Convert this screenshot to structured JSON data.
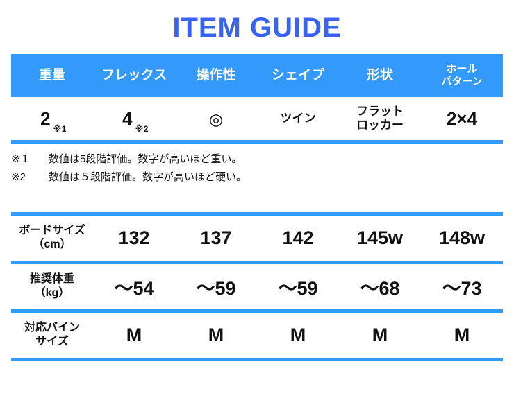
{
  "title": "ITEM GUIDE",
  "colors": {
    "title_blue": "#3663ef",
    "table_blue": "#3399fb",
    "text": "#111111",
    "background": "#ffffff"
  },
  "spec_table": {
    "headers": [
      {
        "label": "重量",
        "line2": ""
      },
      {
        "label": "フレックス",
        "line2": ""
      },
      {
        "label": "操作性",
        "line2": ""
      },
      {
        "label": "シェイプ",
        "line2": ""
      },
      {
        "label": "形状",
        "line2": ""
      },
      {
        "label": "ホール",
        "line2": "パターン"
      }
    ],
    "values": [
      {
        "main": "2",
        "note": "※1",
        "line2": ""
      },
      {
        "main": "4",
        "note": "※2",
        "line2": ""
      },
      {
        "main": "◎",
        "note": "",
        "line2": ""
      },
      {
        "main": "ツイン",
        "note": "",
        "line2": ""
      },
      {
        "main": "フラット",
        "note": "",
        "line2": "ロッカー"
      },
      {
        "main": "2×4",
        "note": "",
        "line2": ""
      }
    ]
  },
  "footnotes": [
    {
      "marker": "※１",
      "text": "数値は5段階評価。数字が高いほど重い。"
    },
    {
      "marker": "※2",
      "text": "数値は５段階評価。数字が高いほど硬い。"
    }
  ],
  "size_table": {
    "rows": [
      {
        "label": "ボードサイズ",
        "unit": "（cm）",
        "values": [
          "132",
          "137",
          "142",
          "145w",
          "148w"
        ]
      },
      {
        "label": "推奨体重",
        "unit": "（kg）",
        "values": [
          "〜54",
          "〜59",
          "〜59",
          "〜68",
          "〜73"
        ]
      },
      {
        "label": "対応バイン",
        "unit": "サイズ",
        "values": [
          "M",
          "M",
          "M",
          "M",
          "M"
        ]
      }
    ]
  }
}
